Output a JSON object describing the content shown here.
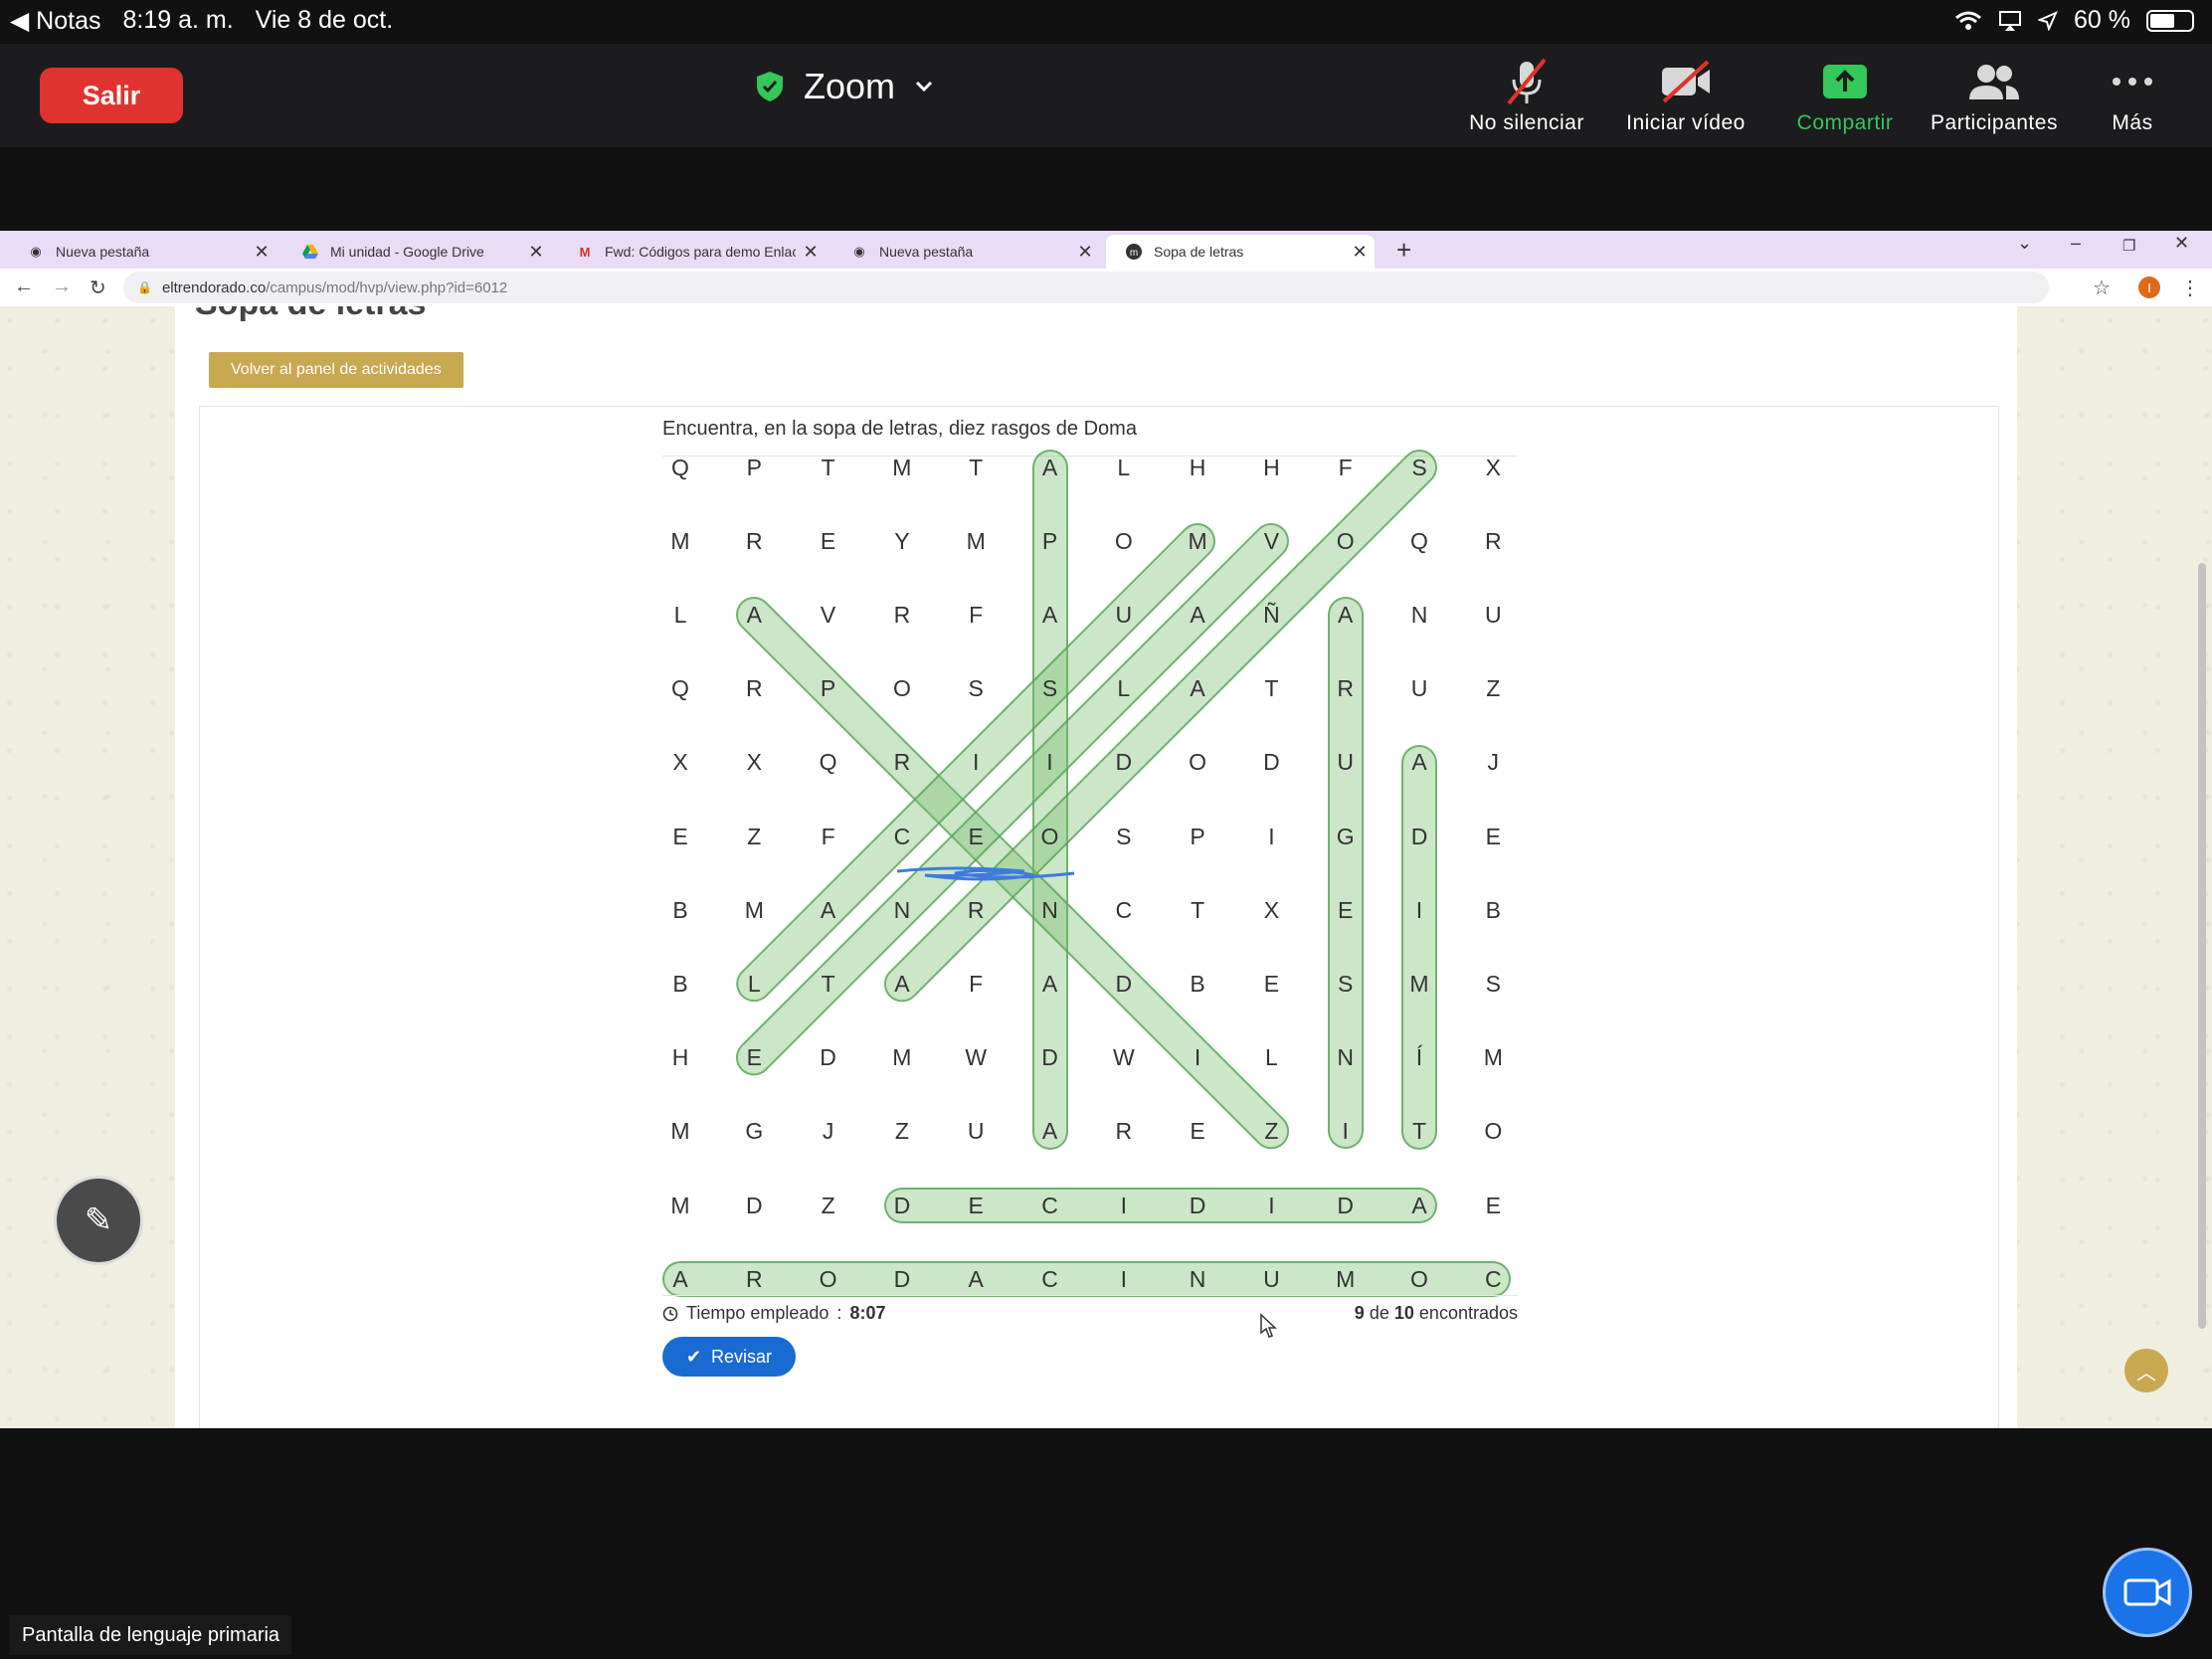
{
  "status_bar": {
    "back_app": "Notas",
    "time": "8:19 a. m.",
    "date": "Vie 8 de oct.",
    "battery": "60 %",
    "battery_level": 0.6
  },
  "zoom": {
    "exit_label": "Salir",
    "title": "Zoom",
    "buttons": [
      {
        "label": "No silenciar",
        "icon": "mic-muted-icon"
      },
      {
        "label": "Iniciar vídeo",
        "icon": "video-off-icon"
      },
      {
        "label": "Compartir",
        "icon": "share-icon"
      },
      {
        "label": "Participantes",
        "icon": "participants-icon"
      },
      {
        "label": "Más",
        "icon": "more-icon"
      }
    ],
    "share_color": "#34c759",
    "exit_color": "#e0322e"
  },
  "browser": {
    "tabs": [
      {
        "title": "Nueva pestaña",
        "icon": "chrome-icon"
      },
      {
        "title": "Mi unidad - Google Drive",
        "icon": "drive-icon"
      },
      {
        "title": "Fwd: Códigos para demo Enlace",
        "icon": "gmail-icon"
      },
      {
        "title": "Nueva pestaña",
        "icon": "chrome-icon"
      },
      {
        "title": "Sopa de letras",
        "icon": "moodle-icon",
        "active": true
      }
    ],
    "url_host": "eltrendorado.co",
    "url_path": "/campus/mod/hvp/view.php?id=6012",
    "profile_initial": "I"
  },
  "page": {
    "cut_title": "Sopa de letras",
    "back_button": "Volver al panel de actividades",
    "instructions": "Encuentra, en la sopa de letras, diez rasgos de Doma",
    "grid": [
      [
        "Q",
        "P",
        "T",
        "M",
        "T",
        "A",
        "L",
        "H",
        "H",
        "F",
        "S",
        "X"
      ],
      [
        "M",
        "R",
        "E",
        "Y",
        "M",
        "P",
        "O",
        "M",
        "V",
        "O",
        "Q",
        "R"
      ],
      [
        "L",
        "A",
        "V",
        "R",
        "F",
        "A",
        "U",
        "A",
        "Ñ",
        "A",
        "N",
        "U"
      ],
      [
        "Q",
        "R",
        "P",
        "O",
        "S",
        "S",
        "L",
        "A",
        "T",
        "R",
        "U",
        "Z"
      ],
      [
        "X",
        "X",
        "Q",
        "R",
        "I",
        "I",
        "D",
        "O",
        "D",
        "U",
        "A",
        "J"
      ],
      [
        "E",
        "Z",
        "F",
        "C",
        "E",
        "O",
        "S",
        "P",
        "I",
        "G",
        "D",
        "E"
      ],
      [
        "B",
        "M",
        "A",
        "N",
        "R",
        "N",
        "C",
        "T",
        "X",
        "E",
        "I",
        "B"
      ],
      [
        "B",
        "L",
        "T",
        "A",
        "F",
        "A",
        "D",
        "B",
        "E",
        "S",
        "M",
        "S"
      ],
      [
        "H",
        "E",
        "D",
        "M",
        "W",
        "D",
        "W",
        "I",
        "L",
        "N",
        "Í",
        "M"
      ],
      [
        "M",
        "G",
        "J",
        "Z",
        "U",
        "A",
        "R",
        "E",
        "Z",
        "I",
        "T",
        "O"
      ],
      [
        "M",
        "D",
        "Z",
        "D",
        "E",
        "C",
        "I",
        "D",
        "I",
        "D",
        "A",
        "E"
      ],
      [
        "A",
        "R",
        "O",
        "D",
        "A",
        "C",
        "I",
        "N",
        "U",
        "M",
        "O",
        "C"
      ]
    ],
    "found_words": [
      {
        "start": [
          0,
          5
        ],
        "end": [
          9,
          5
        ]
      },
      {
        "start": [
          2,
          1
        ],
        "end": [
          9,
          8
        ]
      },
      {
        "start": [
          1,
          7
        ],
        "end": [
          7,
          1
        ]
      },
      {
        "start": [
          1,
          8
        ],
        "end": [
          8,
          1
        ]
      },
      {
        "start": [
          0,
          10
        ],
        "end": [
          7,
          3
        ]
      },
      {
        "start": [
          2,
          9
        ],
        "end": [
          9,
          9
        ]
      },
      {
        "start": [
          4,
          10
        ],
        "end": [
          9,
          10
        ]
      },
      {
        "start": [
          10,
          3
        ],
        "end": [
          10,
          10
        ]
      },
      {
        "start": [
          11,
          0
        ],
        "end": [
          11,
          11
        ]
      }
    ],
    "time_label": "Tiempo empleado",
    "time_value": "8:07",
    "found_count": "9",
    "found_sep": "de",
    "found_total": "10",
    "found_label": "encontrados",
    "check_button": "Revisar"
  },
  "caption": "Pantalla de lenguaje primaria"
}
